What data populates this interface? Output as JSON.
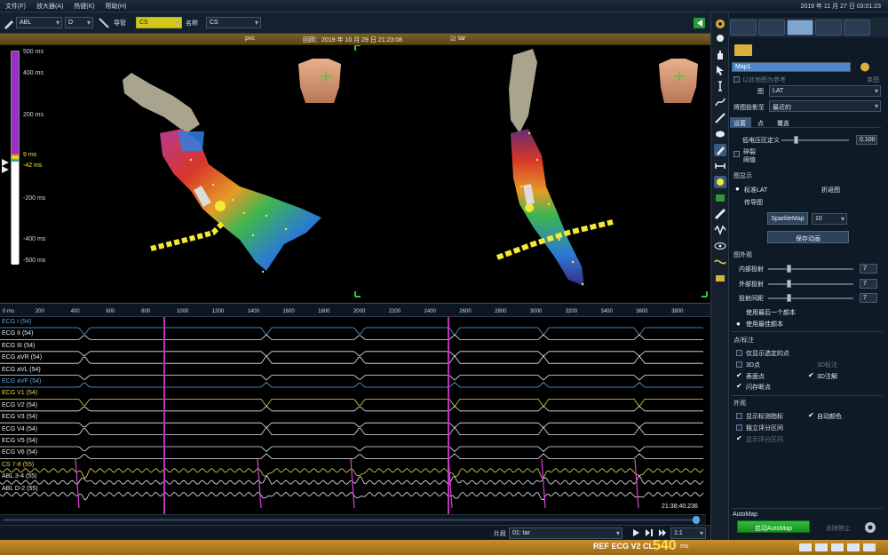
{
  "menu": {
    "items": [
      "文件(F)",
      "放大器(A)",
      "热键(K)",
      "帮助(H)"
    ],
    "clock": "2019 年 11 月 27 日 03:01:23"
  },
  "toolbar": {
    "map_select": "ABL",
    "channel_select": "D",
    "catheter_label": "导管",
    "catheter_value": "CS",
    "name_label": "名称",
    "name_value": "CS"
  },
  "map_header": {
    "name": "pvc",
    "timestamp": "回顾：2019 年 10 月 29 日 21:23:08",
    "tag": "tar"
  },
  "lat_scale": {
    "labels": [
      "500 ms",
      "400 ms",
      "200 ms",
      "9 ms",
      "-42 ms",
      "-200 ms",
      "-400 ms",
      "-500 ms"
    ],
    "top_ms": 500,
    "bottom_ms": -500
  },
  "ecg": {
    "ruler_unit": "ms",
    "ruler_ticks": [
      "200",
      "400",
      "600",
      "800",
      "1000",
      "1200",
      "1400",
      "1600",
      "1800",
      "2000",
      "2200",
      "2400",
      "2600",
      "2800",
      "3000",
      "3200",
      "3400",
      "3600",
      "3800"
    ],
    "ruler_first": "0 ms",
    "leads": [
      {
        "label": "ECG I (54)",
        "color": "#59a9e8"
      },
      {
        "label": "ECG II (54)",
        "color": "#e6ecf2"
      },
      {
        "label": "ECG III (54)",
        "color": "#e6ecf2"
      },
      {
        "label": "ECG aVR (54)",
        "color": "#e6ecf2"
      },
      {
        "label": "ECG aVL (54)",
        "color": "#e6ecf2"
      },
      {
        "label": "ECG aVF (54)",
        "color": "#59a9e8"
      },
      {
        "label": "ECG V1 (54)",
        "color": "#e6d84a"
      },
      {
        "label": "ECG V2 (54)",
        "color": "#e6ecf2"
      },
      {
        "label": "ECG V3 (54)",
        "color": "#e6ecf2"
      },
      {
        "label": "ECG V4 (54)",
        "color": "#e6ecf2"
      },
      {
        "label": "ECG V5 (54)",
        "color": "#e6ecf2"
      },
      {
        "label": "ECG V6 (54)",
        "color": "#e6ecf2"
      },
      {
        "label": "CS   7-8 (55)",
        "color": "#e6d84a"
      },
      {
        "label": "ABL   3-4 (55)",
        "color": "#e6ecf2"
      },
      {
        "label": "ABL   D-2 (55)",
        "color": "#e6ecf2"
      }
    ],
    "time_stamp": "21:38:40.236",
    "segment_label": "片段",
    "segment_value": "01: tar",
    "speed": "1:1"
  },
  "status": {
    "ref": "REF ECG V2 CL",
    "cl_value": "540",
    "unit": "ms"
  },
  "panel": {
    "map_name": "Map1",
    "checkbox_ref": "以此地图为参考",
    "checkbox_ref_right": "单图",
    "map_label": "图",
    "map_value": "LAT",
    "projection_label": "将图投影至",
    "projection_value": "最近的",
    "tabs": [
      "设置",
      "点",
      "覆盖"
    ],
    "low_voltage_label": "低电压区定义",
    "low_voltage_value": "0.100",
    "fragment_label": "碎裂",
    "threshold_label": "阈值",
    "display_section": "图显示",
    "radio_lat": "标准LAT",
    "radio_fold": "折返图",
    "radio_prop": "传导图",
    "sparkle_btn": "SparkleMap",
    "sparkle_value": "10",
    "save_anim_btn": "保存动画",
    "appearance_section": "图外观",
    "inner_proj": "内部投射",
    "inner_val": "7",
    "outer_proj": "外部投射",
    "outer_val": "7",
    "proj_gap": "投射间距",
    "gap_val": "7",
    "use_last": "使用最后一个颜本",
    "use_best": "使用最佳颜本",
    "points_section": "点/标注",
    "only_selected": "仅显示选定的点",
    "pts_3d": "3D点",
    "ann_3d": "3D标注",
    "surface_pts": "表面点",
    "ann_3d_2": "3D注解",
    "flash_pts": "闪存断点",
    "appearance2": "外观",
    "show_marks": "显示标测指标",
    "auto_color": "自动颜色",
    "indep_window": "独立评分区间",
    "show_window": "显示评分区间",
    "automap_label": "AutoMap",
    "automap_btn": "启动AutoMap",
    "stop_btn": "去除禁止"
  }
}
